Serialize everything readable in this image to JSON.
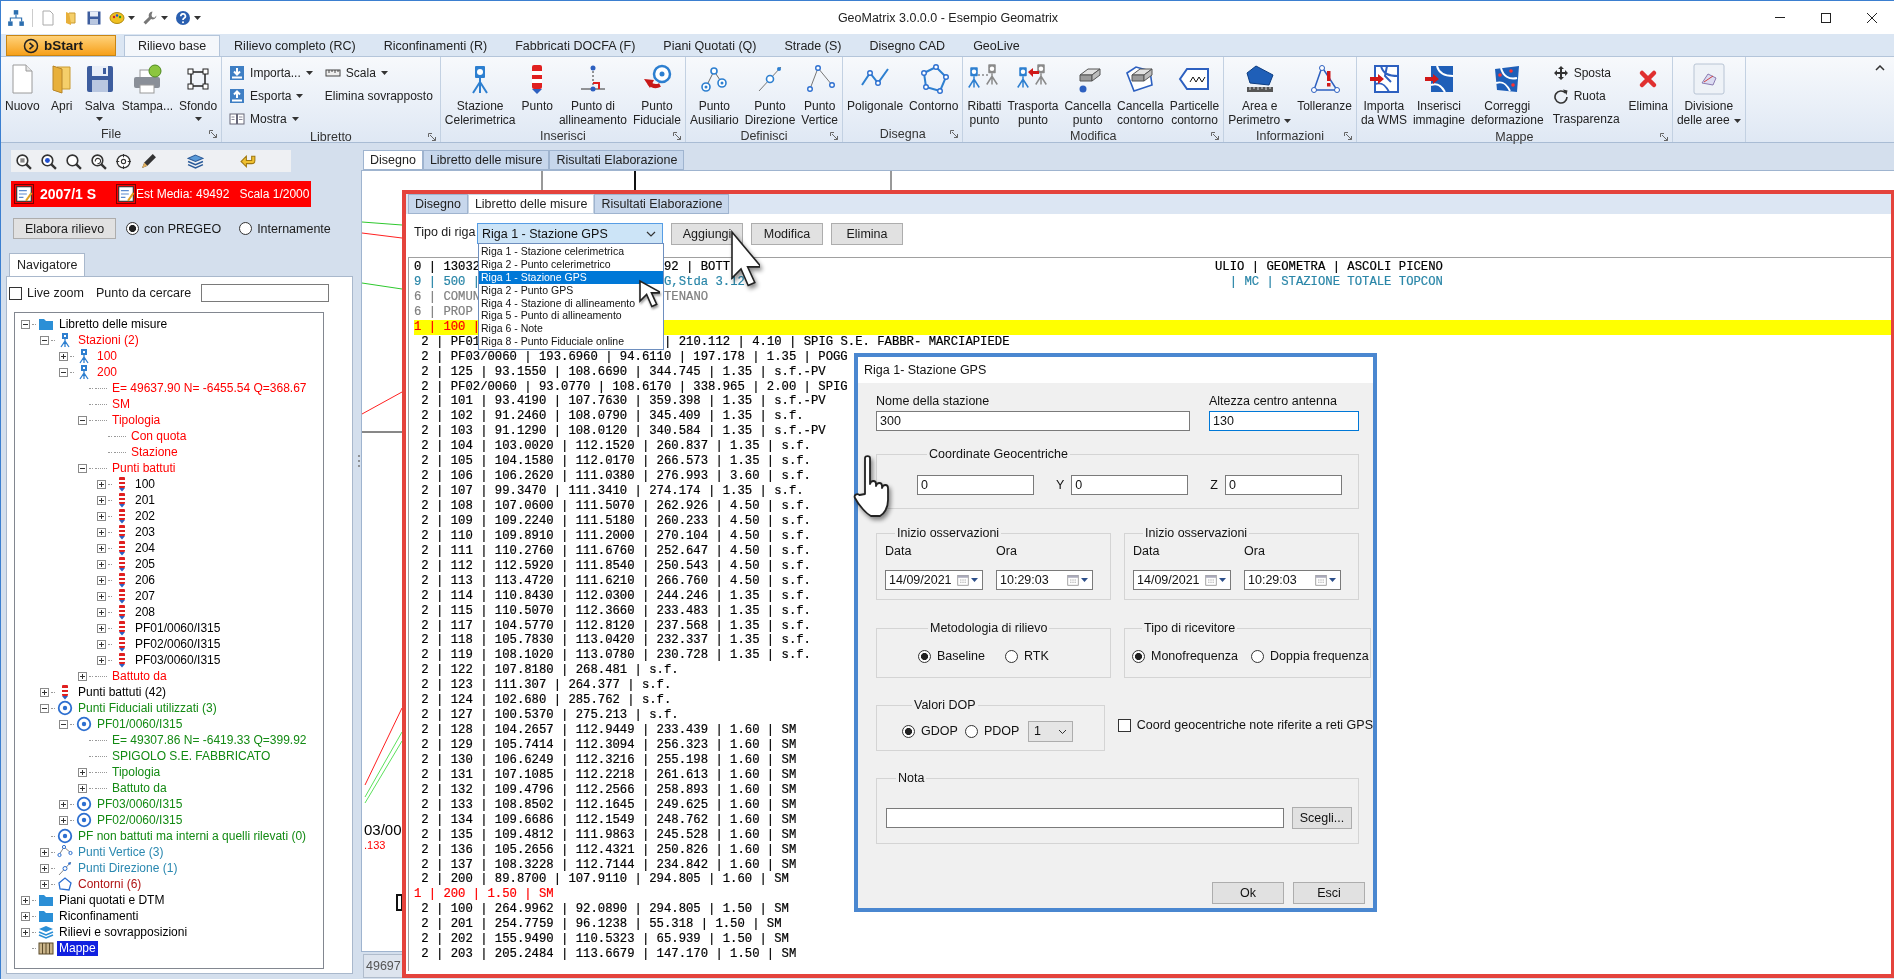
{
  "window": {
    "title": "GeoMatrix 3.0.0.0 - Esempio Geomatrix"
  },
  "ribbon": {
    "app_button": "bStart",
    "tabs": [
      {
        "label": "Rilievo base",
        "selected": true
      },
      {
        "label": "Rilievo completo (RC)",
        "selected": false
      },
      {
        "label": "Riconfinamenti (R)",
        "selected": false
      },
      {
        "label": "Fabbricati DOCFA (F)",
        "selected": false
      },
      {
        "label": "Piani Quotati (Q)",
        "selected": false
      },
      {
        "label": "Strade (S)",
        "selected": false
      },
      {
        "label": "Disegno CAD",
        "selected": false
      },
      {
        "label": "GeoLive",
        "selected": false
      }
    ],
    "groups": [
      {
        "label": "File",
        "launcher": true,
        "items": [
          {
            "kind": "large",
            "label": "Nuovo",
            "menu": false
          },
          {
            "kind": "large",
            "label": "Apri",
            "menu": false
          },
          {
            "kind": "large",
            "label": "Salva",
            "menu": true
          },
          {
            "kind": "large",
            "label": "Stampa...",
            "menu": false
          },
          {
            "kind": "large",
            "label": "Sfondo",
            "menu": true
          }
        ]
      },
      {
        "label": "Libretto",
        "launcher": true,
        "items": [
          {
            "kind": "stack",
            "items": [
              {
                "kind": "small",
                "label": "Importa...",
                "menu": true
              },
              {
                "kind": "small",
                "label": "Esporta",
                "menu": true
              },
              {
                "kind": "small",
                "label": "Mostra",
                "menu": true
              }
            ]
          },
          {
            "kind": "stack",
            "items": [
              {
                "kind": "small",
                "label": "Scala",
                "menu": true
              },
              {
                "kind": "plain",
                "label": "Elimina sovrapposto",
                "menu": false
              }
            ]
          }
        ]
      },
      {
        "label": "Inserisci",
        "launcher": true,
        "items": [
          {
            "kind": "large",
            "label": "Stazione\nCelerimetrica",
            "menu": false
          },
          {
            "kind": "large",
            "label": "Punto",
            "menu": false
          },
          {
            "kind": "large",
            "label": "Punto di\nallineamento",
            "menu": false
          },
          {
            "kind": "large",
            "label": "Punto\nFiduciale",
            "menu": false
          }
        ]
      },
      {
        "label": "Definisci",
        "launcher": true,
        "items": [
          {
            "kind": "large",
            "label": "Punto\nAusiliario",
            "menu": false
          },
          {
            "kind": "large",
            "label": "Punto\nDirezione",
            "menu": false
          },
          {
            "kind": "large",
            "label": "Punto\nVertice",
            "menu": false
          }
        ]
      },
      {
        "label": "Disegna",
        "launcher": true,
        "items": [
          {
            "kind": "large",
            "label": "Poligonale",
            "menu": false
          },
          {
            "kind": "large",
            "label": "Contorno",
            "menu": false
          }
        ]
      },
      {
        "label": "Modifica",
        "launcher": true,
        "items": [
          {
            "kind": "large",
            "label": "Ribatti\npunto",
            "menu": false
          },
          {
            "kind": "large",
            "label": "Trasporta\npunto",
            "menu": false
          },
          {
            "kind": "large",
            "label": "Cancella\npunto",
            "menu": false
          },
          {
            "kind": "large",
            "label": "Cancella\ncontorno",
            "menu": false
          },
          {
            "kind": "large",
            "label": "Particelle\ncontorno",
            "menu": false
          }
        ]
      },
      {
        "label": "Informazioni",
        "launcher": true,
        "items": [
          {
            "kind": "large",
            "label": "Area e\nPerimetro",
            "menu": true
          },
          {
            "kind": "large",
            "label": "Tolleranze",
            "menu": false
          }
        ]
      },
      {
        "label": "Mappe",
        "launcher": true,
        "items": [
          {
            "kind": "large",
            "label": "Importa\nda WMS",
            "menu": false
          },
          {
            "kind": "large",
            "label": "Inserisci\nimmagine",
            "menu": false
          },
          {
            "kind": "large",
            "label": "Correggi\ndeformazione",
            "menu": false
          },
          {
            "kind": "stack",
            "items": [
              {
                "kind": "small",
                "label": "Sposta",
                "menu": false
              },
              {
                "kind": "small",
                "label": "Ruota",
                "menu": false
              },
              {
                "kind": "plain",
                "label": "Trasparenza",
                "menu": false
              }
            ]
          },
          {
            "kind": "large",
            "label": "Elimina",
            "menu": false
          }
        ]
      },
      {
        "launcher": false,
        "items": [
          {
            "kind": "large",
            "label": "Divisione\ndelle aree",
            "menu": true
          }
        ]
      }
    ]
  },
  "sidebar": {
    "survey": {
      "code": "2007/1 S",
      "estimate": "Est Media: 49492",
      "scale": "Scala 1/2000"
    },
    "process_button": "Elabora rilievo",
    "modes": [
      {
        "label": "con PREGEO",
        "selected": true
      },
      {
        "label": "Internamente",
        "selected": false
      }
    ],
    "tabs": [
      {
        "label": "Navigatore",
        "selected": true
      }
    ],
    "live_zoom": {
      "label": "Live zoom",
      "checked": false
    },
    "search": {
      "label": "Punto da cercare"
    },
    "tree": [
      {
        "label": "Libretto delle misure",
        "kind": "folder",
        "color": "#000000",
        "selected": false,
        "expanded": true,
        "children": [
          {
            "label": "Stazioni (2)",
            "kind": "station",
            "color": "#ff0000",
            "selected": false,
            "expanded": true,
            "children": [
              {
                "label": "100",
                "kind": "station",
                "color": "#ff0000",
                "selected": false,
                "expanded": false
              },
              {
                "label": "200",
                "kind": "station",
                "color": "#ff0000",
                "selected": false,
                "expanded": true,
                "children": [
                  {
                    "label": "E= 49637.90 N= -6455.54 Q=368.67",
                    "kind": "text",
                    "color": "#ff0000",
                    "selected": false
                  },
                  {
                    "label": "SM",
                    "kind": "text",
                    "color": "#ff0000",
                    "selected": false
                  },
                  {
                    "label": "Tipologia",
                    "kind": "text",
                    "color": "#ff0000",
                    "selected": false,
                    "expanded": true,
                    "children": [
                      {
                        "label": "Con quota",
                        "kind": "text",
                        "color": "#ff0000",
                        "selected": false
                      },
                      {
                        "label": "Stazione",
                        "kind": "text",
                        "color": "#ff0000",
                        "selected": false
                      }
                    ]
                  },
                  {
                    "label": "Punti battuti",
                    "kind": "text",
                    "color": "#ff0000",
                    "selected": false,
                    "expanded": true,
                    "children": [
                      {
                        "label": "100",
                        "kind": "point",
                        "color": "#000000",
                        "selected": false,
                        "expanded": false
                      },
                      {
                        "label": "201",
                        "kind": "point",
                        "color": "#000000",
                        "selected": false,
                        "expanded": false
                      },
                      {
                        "label": "202",
                        "kind": "point",
                        "color": "#000000",
                        "selected": false,
                        "expanded": false
                      },
                      {
                        "label": "203",
                        "kind": "point",
                        "color": "#000000",
                        "selected": false,
                        "expanded": false
                      },
                      {
                        "label": "204",
                        "kind": "point",
                        "color": "#000000",
                        "selected": false,
                        "expanded": false
                      },
                      {
                        "label": "205",
                        "kind": "point",
                        "color": "#000000",
                        "selected": false,
                        "expanded": false
                      },
                      {
                        "label": "206",
                        "kind": "point",
                        "color": "#000000",
                        "selected": false,
                        "expanded": false
                      },
                      {
                        "label": "207",
                        "kind": "point",
                        "color": "#000000",
                        "selected": false,
                        "expanded": false
                      },
                      {
                        "label": "208",
                        "kind": "point",
                        "color": "#000000",
                        "selected": false,
                        "expanded": false
                      },
                      {
                        "label": "PF01/0060/I315",
                        "kind": "point",
                        "color": "#000000",
                        "selected": false,
                        "expanded": false
                      },
                      {
                        "label": "PF02/0060/I315",
                        "kind": "point",
                        "color": "#000000",
                        "selected": false,
                        "expanded": false
                      },
                      {
                        "label": "PF03/0060/I315",
                        "kind": "point",
                        "color": "#000000",
                        "selected": false,
                        "expanded": false
                      }
                    ]
                  },
                  {
                    "label": "Battuto da",
                    "kind": "text",
                    "color": "#ff0000",
                    "selected": false,
                    "expanded": false
                  }
                ]
              }
            ]
          },
          {
            "label": "Punti battuti (42)",
            "kind": "point",
            "color": "#000000",
            "selected": false,
            "expanded": false
          },
          {
            "label": "Punti Fiduciali utilizzati (3)",
            "kind": "fiducial",
            "color": "#138a13",
            "selected": false,
            "expanded": true,
            "children": [
              {
                "label": "PF01/0060/I315",
                "kind": "fiducial",
                "color": "#138a13",
                "selected": false,
                "expanded": true,
                "children": [
                  {
                    "label": "E= 49307.86 N= -6419.33 Q=399.92",
                    "kind": "text",
                    "color": "#138a13",
                    "selected": false
                  },
                  {
                    "label": "SPIGOLO S.E. FABBRICATO",
                    "kind": "text",
                    "color": "#138a13",
                    "selected": false
                  },
                  {
                    "label": "Tipologia",
                    "kind": "text",
                    "color": "#138a13",
                    "selected": false,
                    "expanded": false
                  },
                  {
                    "label": "Battuto da",
                    "kind": "text",
                    "color": "#138a13",
                    "selected": false,
                    "expanded": false
                  }
                ]
              },
              {
                "label": "PF03/0060/I315",
                "kind": "fiducial",
                "color": "#138a13",
                "selected": false,
                "expanded": false
              },
              {
                "label": "PF02/0060/I315",
                "kind": "fiducial",
                "color": "#138a13",
                "selected": false,
                "expanded": false
              }
            ]
          },
          {
            "label": "PF non battuti ma interni a quelli rilevati (0)",
            "kind": "fiducial",
            "color": "#138a13",
            "selected": false
          },
          {
            "label": "Punti Vertice (3)",
            "kind": "vertex",
            "color": "#2a88b0",
            "selected": false,
            "expanded": false
          },
          {
            "label": "Punti Direzione (1)",
            "kind": "direction",
            "color": "#2a88b0",
            "selected": false,
            "expanded": false
          },
          {
            "label": "Contorni (6)",
            "kind": "contour",
            "color": "#b01515",
            "selected": false,
            "expanded": false
          }
        ]
      },
      {
        "label": "Piani quotati e DTM",
        "kind": "folder",
        "color": "#000000",
        "selected": false,
        "expanded": false
      },
      {
        "label": "Riconfinamenti",
        "kind": "folder",
        "color": "#000000",
        "selected": false,
        "expanded": false
      },
      {
        "label": "Rilievi e sovrapposizioni",
        "kind": "layers",
        "color": "#000000",
        "selected": false,
        "expanded": false
      },
      {
        "label": "Mappe",
        "kind": "map",
        "selected": true
      }
    ]
  },
  "workspace": {
    "tabs": [
      {
        "label": "Disegno",
        "selected": true
      },
      {
        "label": "Libretto delle misure",
        "selected": false
      },
      {
        "label": "Risultati Elaborazione",
        "selected": false
      }
    ],
    "canvas_labels": [
      {
        "text": "03/00",
        "color": "#000000"
      },
      {
        "text": ".133",
        "color": "#ff0000"
      }
    ],
    "status": "49697"
  },
  "inset": {
    "tabs": [
      {
        "label": "Disegno",
        "selected": false
      },
      {
        "label": "Libretto delle misure",
        "selected": true
      },
      {
        "label": "Risultati Elaborazione",
        "selected": false
      }
    ],
    "row_type": {
      "label": "Tipo di riga",
      "value": "Riga 1 - Stazione GPS",
      "expanded": true,
      "options": [
        {
          "label": "Riga 1 - Stazione celerimetrica",
          "selected": false
        },
        {
          "label": "Riga 2 - Punto celerimetrico",
          "selected": false
        },
        {
          "label": "Riga 1 - Stazione GPS",
          "selected": true
        },
        {
          "label": "Riga 2 - Punto GPS",
          "selected": false
        },
        {
          "label": "Riga 4 - Stazione di allineamento",
          "selected": false
        },
        {
          "label": "Riga 5 - Punto di allineamento",
          "selected": false
        },
        {
          "label": "Riga 6 - Note",
          "selected": false
        },
        {
          "label": "Riga 8 - Punto Fiduciale online",
          "selected": false
        }
      ]
    },
    "buttons": [
      "Aggiungi",
      "Modifica",
      "Elimina"
    ],
    "listing": [
      {
        "parts": [
          "0 | 13032",
          "92 | BOTT",
          "ULIO | GEOMETRA | ASCOLI PICENO"
        ],
        "kind": "header",
        "selected": false
      },
      {
        "parts": [
          "9 | 500 |",
          "G,Stda 3.12",
          "| MC | STAZIONE TOTALE TOPCON"
        ],
        "kind": "instrument",
        "selected": false
      },
      {
        "parts": [
          "6 | COMUN",
          "TENANO"
        ],
        "kind": "note",
        "selected": false
      },
      {
        "parts": [
          "6 | PROP"
        ],
        "kind": "note",
        "selected": false
      },
      {
        "parts": [
          "1 | 100 |"
        ],
        "kind": "station",
        "selected": true
      },
      {
        "parts": [
          " 2 | PF01",
          "| 210.112 | 4.10 | SPIG S.E. FABBR- MARCIAPIEDE"
        ],
        "kind": "point",
        "selected": false
      },
      {
        "parts": [
          " 2 | PF03/0060 | 193.6960 | 94.6110 | 197.178 | 1.35 | POGG"
        ],
        "kind": "point",
        "selected": false
      },
      {
        "parts": [
          " 2 | 125 | 93.1550 | 108.6690 | 344.745 | 1.35 | s.f.-PV"
        ],
        "kind": "point",
        "selected": false
      },
      {
        "parts": [
          " 2 | PF02/0060 | 93.0770 | 108.6170 | 338.965 | 2.00 | SPIG"
        ],
        "kind": "point",
        "selected": false
      },
      {
        "parts": [
          " 2 | 101 | 93.4190 | 107.7630 | 359.398 | 1.35 | s.f.-PV"
        ],
        "kind": "point",
        "selected": false
      },
      {
        "parts": [
          " 2 | 102 | 91.2460 | 108.0790 | 345.409 | 1.35 | s.f."
        ],
        "kind": "point",
        "selected": false
      },
      {
        "parts": [
          " 2 | 103 | 91.1290 | 108.0120 | 340.584 | 1.35 | s.f.-PV"
        ],
        "kind": "point",
        "selected": false
      },
      {
        "parts": [
          " 2 | 104 | 103.0020 | 112.1520 | 260.837 | 1.35 | s.f."
        ],
        "kind": "point",
        "selected": false
      },
      {
        "parts": [
          " 2 | 105 | 104.1580 | 112.0170 | 266.573 | 1.35 | s.f."
        ],
        "kind": "point",
        "selected": false
      },
      {
        "parts": [
          " 2 | 106 | 106.2620 | 111.0380 | 276.993 | 3.60 | s.f."
        ],
        "kind": "point",
        "selected": false
      },
      {
        "parts": [
          " 2 | 107 | 99.3470 | 111.3410 | 274.174 | 1.35 | s.f."
        ],
        "kind": "point",
        "selected": false
      },
      {
        "parts": [
          " 2 | 108 | 107.0600 | 111.5070 | 262.926 | 4.50 | s.f."
        ],
        "kind": "point",
        "selected": false
      },
      {
        "parts": [
          " 2 | 109 | 109.2240 | 111.5180 | 260.233 | 4.50 | s.f."
        ],
        "kind": "point",
        "selected": false
      },
      {
        "parts": [
          " 2 | 110 | 109.8910 | 111.2000 | 270.104 | 4.50 | s.f."
        ],
        "kind": "point",
        "selected": false
      },
      {
        "parts": [
          " 2 | 111 | 110.2760 | 111.6760 | 252.647 | 4.50 | s.f."
        ],
        "kind": "point",
        "selected": false
      },
      {
        "parts": [
          " 2 | 112 | 112.5920 | 111.8540 | 250.543 | 4.50 | s.f."
        ],
        "kind": "point",
        "selected": false
      },
      {
        "parts": [
          " 2 | 113 | 113.4720 | 111.6210 | 266.760 | 4.50 | s.f."
        ],
        "kind": "point",
        "selected": false
      },
      {
        "parts": [
          " 2 | 114 | 110.8430 | 112.0300 | 244.246 | 1.35 | s.f."
        ],
        "kind": "point",
        "selected": false
      },
      {
        "parts": [
          " 2 | 115 | 110.5070 | 112.3660 | 233.483 | 1.35 | s.f."
        ],
        "kind": "point",
        "selected": false
      },
      {
        "parts": [
          " 2 | 117 | 104.5770 | 112.8120 | 237.568 | 1.35 | s.f."
        ],
        "kind": "point",
        "selected": false
      },
      {
        "parts": [
          " 2 | 118 | 105.7830 | 113.0420 | 232.337 | 1.35 | s.f."
        ],
        "kind": "point",
        "selected": false
      },
      {
        "parts": [
          " 2 | 119 | 108.1020 | 113.0780 | 230.728 | 1.35 | s.f."
        ],
        "kind": "point",
        "selected": false
      },
      {
        "parts": [
          " 2 | 122 | 107.8180 | 268.481 | s.f."
        ],
        "kind": "point",
        "selected": false
      },
      {
        "parts": [
          " 2 | 123 | 111.307 | 264.377 | s.f."
        ],
        "kind": "point",
        "selected": false
      },
      {
        "parts": [
          " 2 | 124 | 102.680 | 285.762 | s.f."
        ],
        "kind": "point",
        "selected": false
      },
      {
        "parts": [
          " 2 | 127 | 100.5370 | 275.213 | s.f."
        ],
        "kind": "point",
        "selected": false
      },
      {
        "parts": [
          " 2 | 128 | 104.2657 | 112.9449 | 233.439 | 1.60 | SM"
        ],
        "kind": "point",
        "selected": false
      },
      {
        "parts": [
          " 2 | 129 | 105.7414 | 112.3094 | 256.323 | 1.60 | SM"
        ],
        "kind": "point",
        "selected": false
      },
      {
        "parts": [
          " 2 | 130 | 106.6249 | 112.3216 | 255.198 | 1.60 | SM"
        ],
        "kind": "point",
        "selected": false
      },
      {
        "parts": [
          " 2 | 131 | 107.1085 | 112.2218 | 261.613 | 1.60 | SM"
        ],
        "kind": "point",
        "selected": false
      },
      {
        "parts": [
          " 2 | 132 | 109.4796 | 112.2566 | 258.893 | 1.60 | SM"
        ],
        "kind": "point",
        "selected": false
      },
      {
        "parts": [
          " 2 | 133 | 108.8502 | 112.1645 | 249.625 | 1.60 | SM"
        ],
        "kind": "point",
        "selected": false
      },
      {
        "parts": [
          " 2 | 134 | 109.6686 | 112.1549 | 248.762 | 1.60 | SM"
        ],
        "kind": "point",
        "selected": false
      },
      {
        "parts": [
          " 2 | 135 | 109.4812 | 111.9863 | 245.528 | 1.60 | SM"
        ],
        "kind": "point",
        "selected": false
      },
      {
        "parts": [
          " 2 | 136 | 105.2656 | 112.4321 | 250.826 | 1.60 | SM"
        ],
        "kind": "point",
        "selected": false
      },
      {
        "parts": [
          " 2 | 137 | 108.3228 | 112.7144 | 234.842 | 1.60 | SM"
        ],
        "kind": "point",
        "selected": false
      },
      {
        "parts": [
          " 2 | 200 | 89.8700 | 107.9110 | 294.805 | 1.60 | SM"
        ],
        "kind": "point",
        "selected": false
      },
      {
        "parts": [
          "1 | 200 | 1.50 | SM"
        ],
        "kind": "station",
        "selected": false
      },
      {
        "parts": [
          " 2 | 100 | 264.9962 | 92.0890 | 294.805 | 1.50 | SM"
        ],
        "kind": "point",
        "selected": false
      },
      {
        "parts": [
          " 2 | 201 | 254.7759 | 96.1238 | 55.318 | 1.50 | SM"
        ],
        "kind": "point",
        "selected": false
      },
      {
        "parts": [
          " 2 | 202 | 155.9490 | 110.5323 | 65.939 | 1.50 | SM"
        ],
        "kind": "point",
        "selected": false
      },
      {
        "parts": [
          " 2 | 203 | 205.2484 | 113.6679 | 147.170 | 1.50 | SM"
        ],
        "kind": "point",
        "selected": false
      }
    ]
  },
  "dialog": {
    "title": "Riga 1- Stazione GPS",
    "station_name": {
      "label": "Nome della stazione",
      "value": "300"
    },
    "antenna_height": {
      "label": "Altezza centro antenna",
      "value": "130",
      "focused": true
    },
    "geocentric": {
      "title": "Coordinate Geocentriche",
      "fields": [
        {
          "value": "0"
        },
        {
          "label": "Y",
          "value": "0"
        },
        {
          "label": "Z",
          "value": "0"
        }
      ]
    },
    "observations": [
      {
        "title": "Inizio osservazioni",
        "date_label": "Data",
        "date": "14/09/2021",
        "time_label": "Ora",
        "time": "10:29:03"
      },
      {
        "title": "Inizio osservazioni",
        "date_label": "Data",
        "date": "14/09/2021",
        "time_label": "Ora",
        "time": "10:29:03"
      }
    ],
    "method": {
      "title": "Metodologia di rilievo",
      "options": [
        {
          "label": "Baseline",
          "selected": true
        },
        {
          "label": "RTK",
          "selected": false
        }
      ]
    },
    "receiver": {
      "title": "Tipo di ricevitore",
      "options": [
        {
          "label": "Monofrequenza",
          "selected": true
        },
        {
          "label": "Doppia frequenza",
          "selected": false
        }
      ]
    },
    "dop": {
      "title": "Valori DOP",
      "options": [
        {
          "label": "GDOP",
          "selected": true
        },
        {
          "label": "PDOP",
          "selected": false
        }
      ],
      "value": "1"
    },
    "gps_networks": {
      "label": "Coord geocentriche note riferite a reti GPS",
      "checked": false
    },
    "note": {
      "title": "Nota",
      "button": "Scegli..."
    },
    "buttons": [
      "Ok",
      "Esci"
    ]
  }
}
